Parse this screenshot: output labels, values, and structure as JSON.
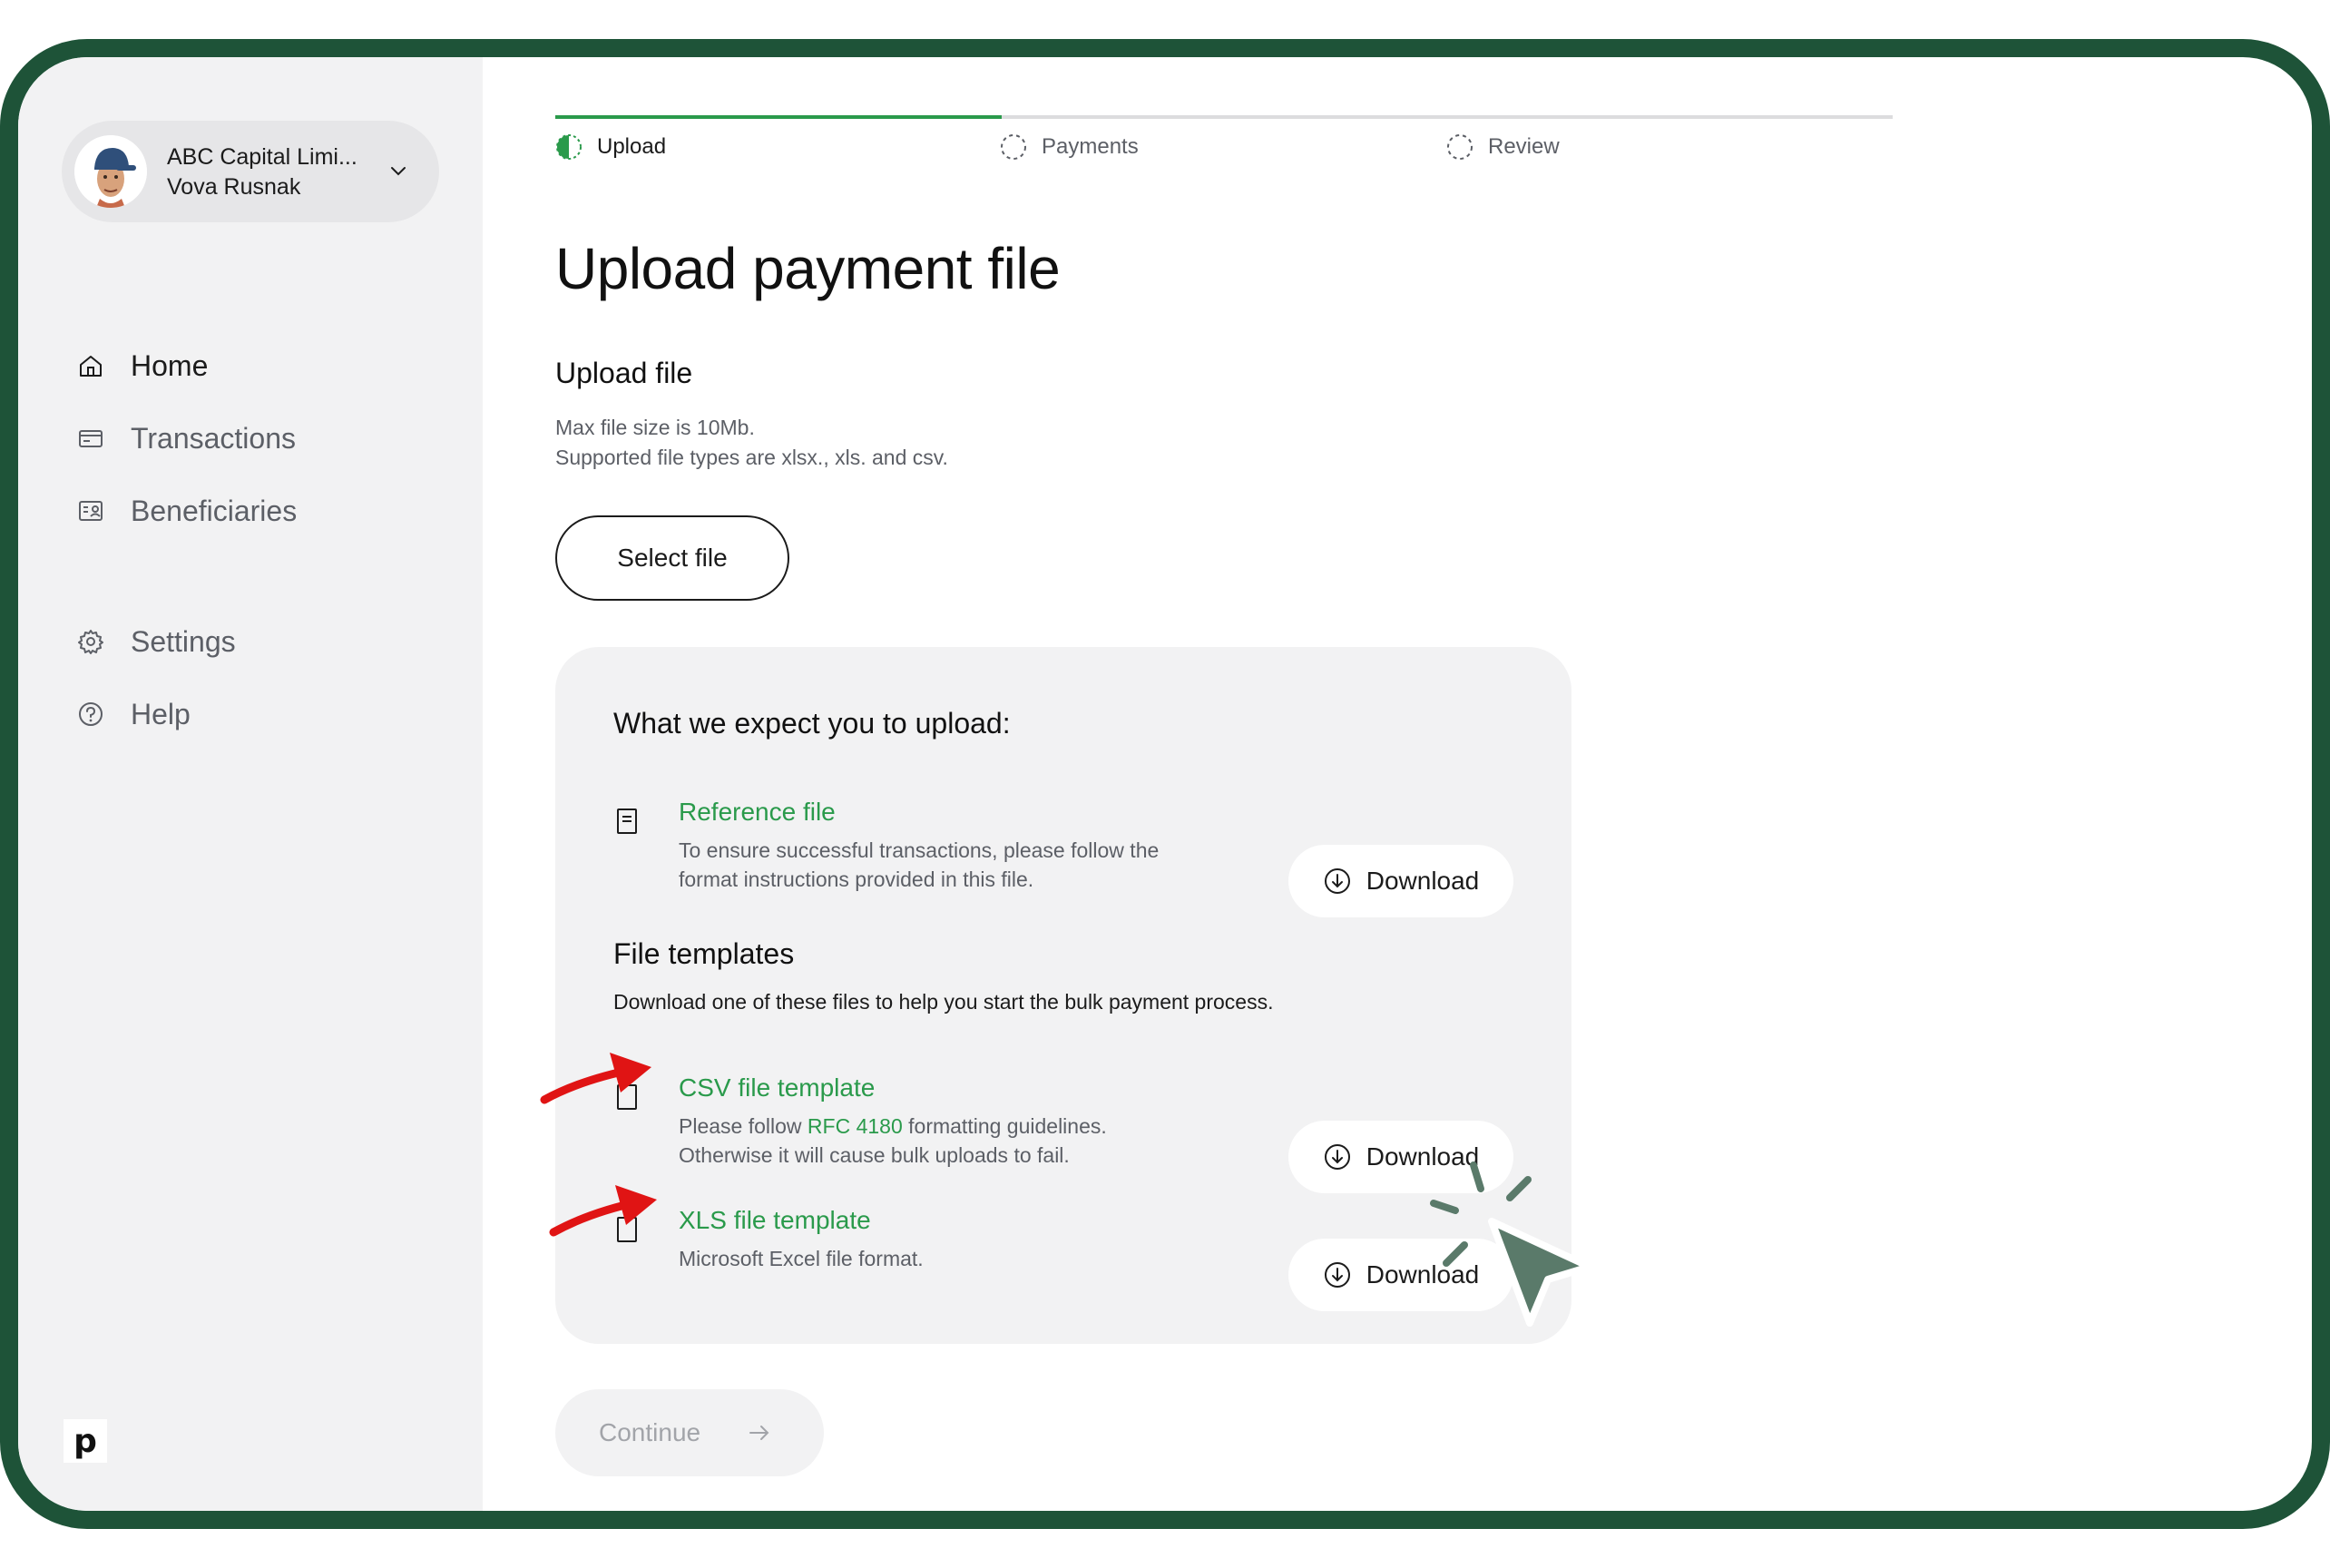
{
  "account": {
    "company": "ABC Capital Limi...",
    "user": "Vova Rusnak"
  },
  "nav": {
    "items": [
      {
        "label": "Home",
        "icon": "home-icon",
        "active": true
      },
      {
        "label": "Transactions",
        "icon": "card-icon",
        "active": false
      },
      {
        "label": "Beneficiaries",
        "icon": "contacts-icon",
        "active": false
      },
      {
        "label": "Settings",
        "icon": "gear-icon",
        "active": false
      },
      {
        "label": "Help",
        "icon": "help-icon",
        "active": false
      }
    ]
  },
  "brand": {
    "logo_letter": "p"
  },
  "steps": [
    {
      "label": "Upload",
      "state": "current"
    },
    {
      "label": "Payments",
      "state": "pending"
    },
    {
      "label": "Review",
      "state": "pending"
    }
  ],
  "page": {
    "title": "Upload payment file",
    "section_title": "Upload file",
    "hint_line1": "Max file size is 10Mb.",
    "hint_line2": "Supported file types are xlsx., xls. and csv.",
    "select_button": "Select file"
  },
  "expectations": {
    "heading": "What we expect you to upload:",
    "reference": {
      "name": "Reference file",
      "desc_line1": "To ensure successful transactions, please follow the",
      "desc_line2": "format instructions provided in this file.",
      "button": "Download"
    },
    "templates_title": "File templates",
    "templates_sub": "Download one of these files to help you start the bulk payment process.",
    "csv": {
      "name": "CSV file template",
      "desc_pre": "Please follow ",
      "desc_link": "RFC 4180",
      "desc_post": " formatting guidelines.",
      "desc_line2": "Otherwise it will cause bulk uploads to fail.",
      "button": "Download"
    },
    "xls": {
      "name": "XLS file template",
      "desc_line1": "Microsoft Excel file format.",
      "button": "Download"
    }
  },
  "footer": {
    "continue_button": "Continue"
  },
  "colors": {
    "accent": "#2a9a4b",
    "frame": "#1e5338",
    "annotation_arrow": "#e01414",
    "cursor": "#5a7a6a"
  }
}
